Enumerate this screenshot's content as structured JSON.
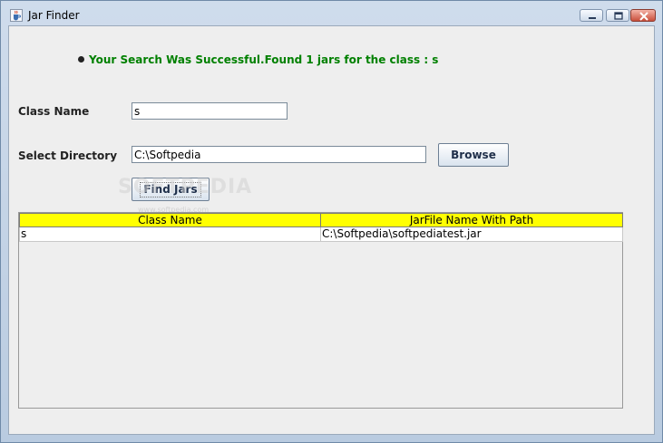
{
  "window": {
    "title": "Jar Finder",
    "controls": [
      "minimize-icon",
      "maximize-icon",
      "close-icon"
    ]
  },
  "status": {
    "message": "Your Search Was Successful.Found 1 jars for the class : s",
    "color": "#008000"
  },
  "form": {
    "class_name_label": "Class Name",
    "class_name_value": "s",
    "directory_label": "Select Directory",
    "directory_value": "C:\\Softpedia",
    "browse_label": "Browse",
    "find_label": "Find Jars"
  },
  "table": {
    "header_color": "#ffff00",
    "columns": [
      "Class Name",
      "JarFile Name With Path"
    ],
    "rows": [
      [
        "s",
        "C:\\Softpedia\\softpediatest.jar"
      ]
    ]
  },
  "watermark": {
    "text": "SOFTPEDIA",
    "sub": "www.softpedia.com"
  }
}
